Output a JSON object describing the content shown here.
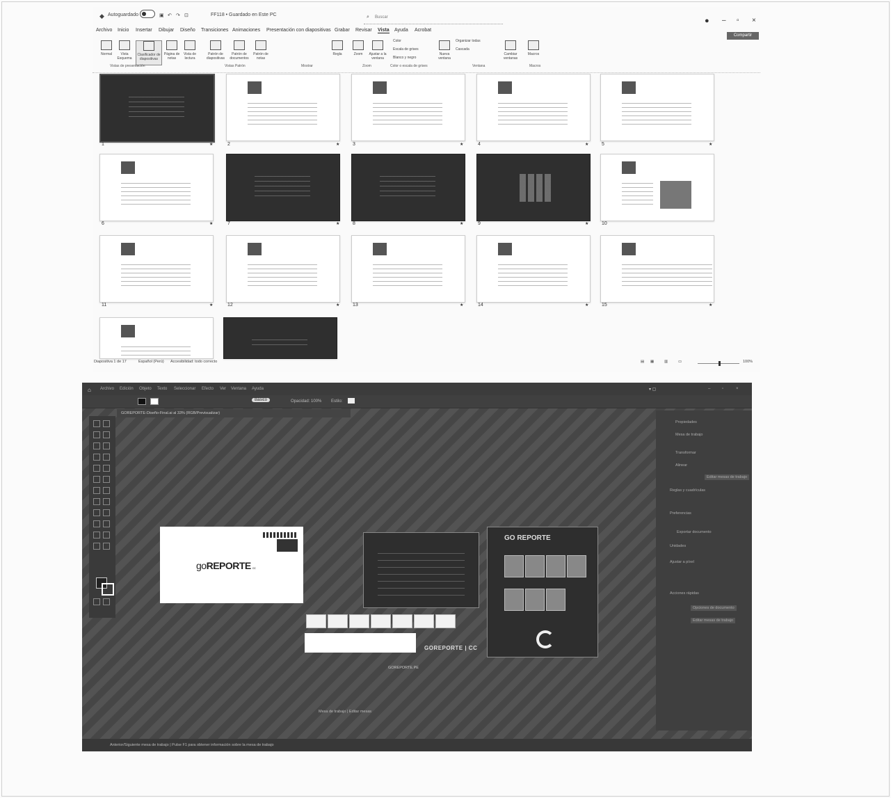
{
  "powerpoint": {
    "titlebar": {
      "autosave_label": "Autoguardado",
      "filename": "FF118 • Guardado en Este PC",
      "search_placeholder": "Buscar"
    },
    "share_label": "Compartir",
    "menu_tabs": [
      "Archivo",
      "Inicio",
      "Insertar",
      "Dibujar",
      "Diseño",
      "Transiciones",
      "Animaciones",
      "Presentación con diapositivas",
      "Grabar",
      "Revisar",
      "Vista",
      "Ayuda",
      "Acrobat"
    ],
    "active_tab": "Vista",
    "ribbon": {
      "buttons": [
        "Normal",
        "Vista Esquema",
        "Clasificador de diapositivas",
        "Página de notas",
        "Vista de lectura",
        "Patrón de diapositivas",
        "Patrón de documentos",
        "Patrón de notas",
        "Regla",
        "Zoom",
        "Ajustar a la ventana",
        "Color",
        "Escala de grises",
        "Blanco y negro",
        "Nueva ventana",
        "Organizar todas",
        "Cascada",
        "Cambiar ventanas",
        "Macros"
      ],
      "selected_button": "Clasificador de diapositivas",
      "group_labels": [
        "Vistas de presentación",
        "Vistas Patrón",
        "Mostrar",
        "Zoom",
        "Color o escala de grises",
        "Ventana",
        "Macros"
      ]
    },
    "slide_numbers": [
      "1",
      "2",
      "3",
      "4",
      "5",
      "6",
      "7",
      "8",
      "9",
      "10",
      "11",
      "12",
      "13",
      "14",
      "15"
    ],
    "statusbar": {
      "slide_info": "Diapositiva 1 de 17",
      "language": "Español (Perú)",
      "accessibility": "Accesibilidad: todo correcto",
      "zoom_percent": "100%"
    }
  },
  "illustrator": {
    "menus": [
      "Archivo",
      "Edición",
      "Objeto",
      "Texto",
      "Seleccionar",
      "Efecto",
      "Ver",
      "Ventana",
      "Ayuda"
    ],
    "control_bar": {
      "mode_label": "Básico",
      "opacity_label": "Opacidad: 100%",
      "style_label": "Estilo:"
    },
    "doc_tab": "GOREPORTE-Diseño-Final.ai al 33% (RGB/Previsualizar)",
    "panel": {
      "items": [
        "Propiedades",
        "Mesa de trabajo",
        "Transformar",
        "Alinear",
        "Editar mesas de trabajo",
        "Reglas y cuadrículas",
        "Preferencias",
        "Exportar documento",
        "Unidades",
        "Ajustar a píxel",
        "Acciones rápidas",
        "Opciones de documento",
        "Editar mesas de trabajo"
      ]
    },
    "artwork": {
      "logo_text_go": "go",
      "logo_text_main": "REPORTE",
      "logo_tag": "CC",
      "artboard3_title": "GO REPORTE",
      "logo_line": "GOREPORTE | CC",
      "caption": "GOREPORTE.PE"
    },
    "status_text": "Anterior/Siguiente mesa de trabajo  |  Pulse F1 para obtener información sobre la mesa de trabajo",
    "bottom_tools": "Mesa de trabajo  |  Editar mesas"
  }
}
